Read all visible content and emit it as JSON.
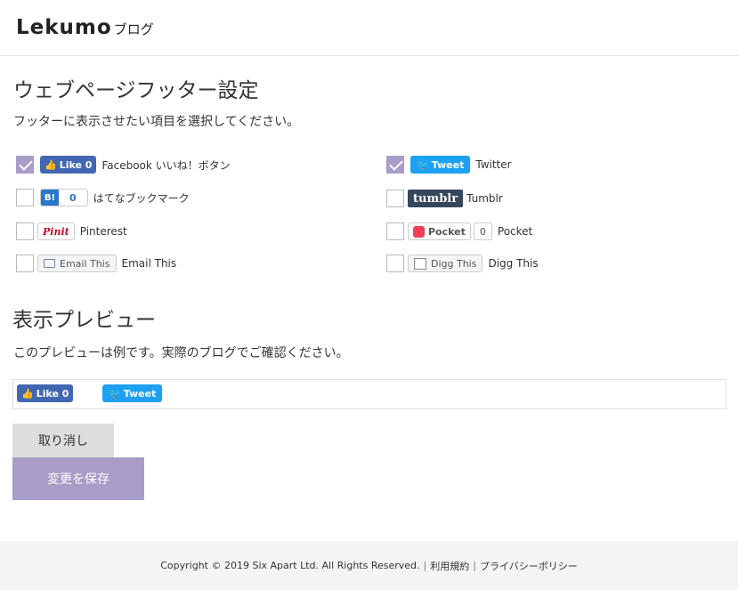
{
  "header": {
    "logo_main": "Lekumo",
    "logo_sub": "ブログ"
  },
  "page": {
    "title": "ウェブページフッター設定",
    "description": "フッターに表示させたい項目を選択してください。"
  },
  "options": {
    "facebook": {
      "button": "Like 0",
      "label": "Facebook いいね！ボタン",
      "checked": true
    },
    "twitter": {
      "button": "Tweet",
      "label": "Twitter",
      "checked": true
    },
    "hatena": {
      "button_icon": "B!",
      "button_count": "0",
      "label": "はてなブックマーク",
      "checked": false
    },
    "tumblr": {
      "button": "tumblr",
      "label": "Tumblr",
      "checked": false
    },
    "pinterest": {
      "button": "Pinit",
      "label": "Pinterest",
      "checked": false
    },
    "pocket": {
      "button": "Pocket",
      "count": "0",
      "label": "Pocket",
      "checked": false
    },
    "email": {
      "button": "Email This",
      "label": "Email This",
      "checked": false
    },
    "digg": {
      "button": "Digg This",
      "label": "Digg This",
      "checked": false
    }
  },
  "preview": {
    "title": "表示プレビュー",
    "description": "このプレビューは例です。実際のブログでご確認ください。",
    "facebook": "Like 0",
    "twitter": "Tweet"
  },
  "buttons": {
    "cancel": "取り消し",
    "save": "変更を保存"
  },
  "footer": {
    "copyright": "Copyright © 2019 Six Apart Ltd. All Rights Reserved.",
    "terms": "利用規約",
    "privacy": "プライバシーポリシー"
  },
  "colors": {
    "accent": "#a99cc7",
    "facebook": "#4267b2",
    "twitter": "#1da1f2",
    "tumblr": "#36465d"
  }
}
